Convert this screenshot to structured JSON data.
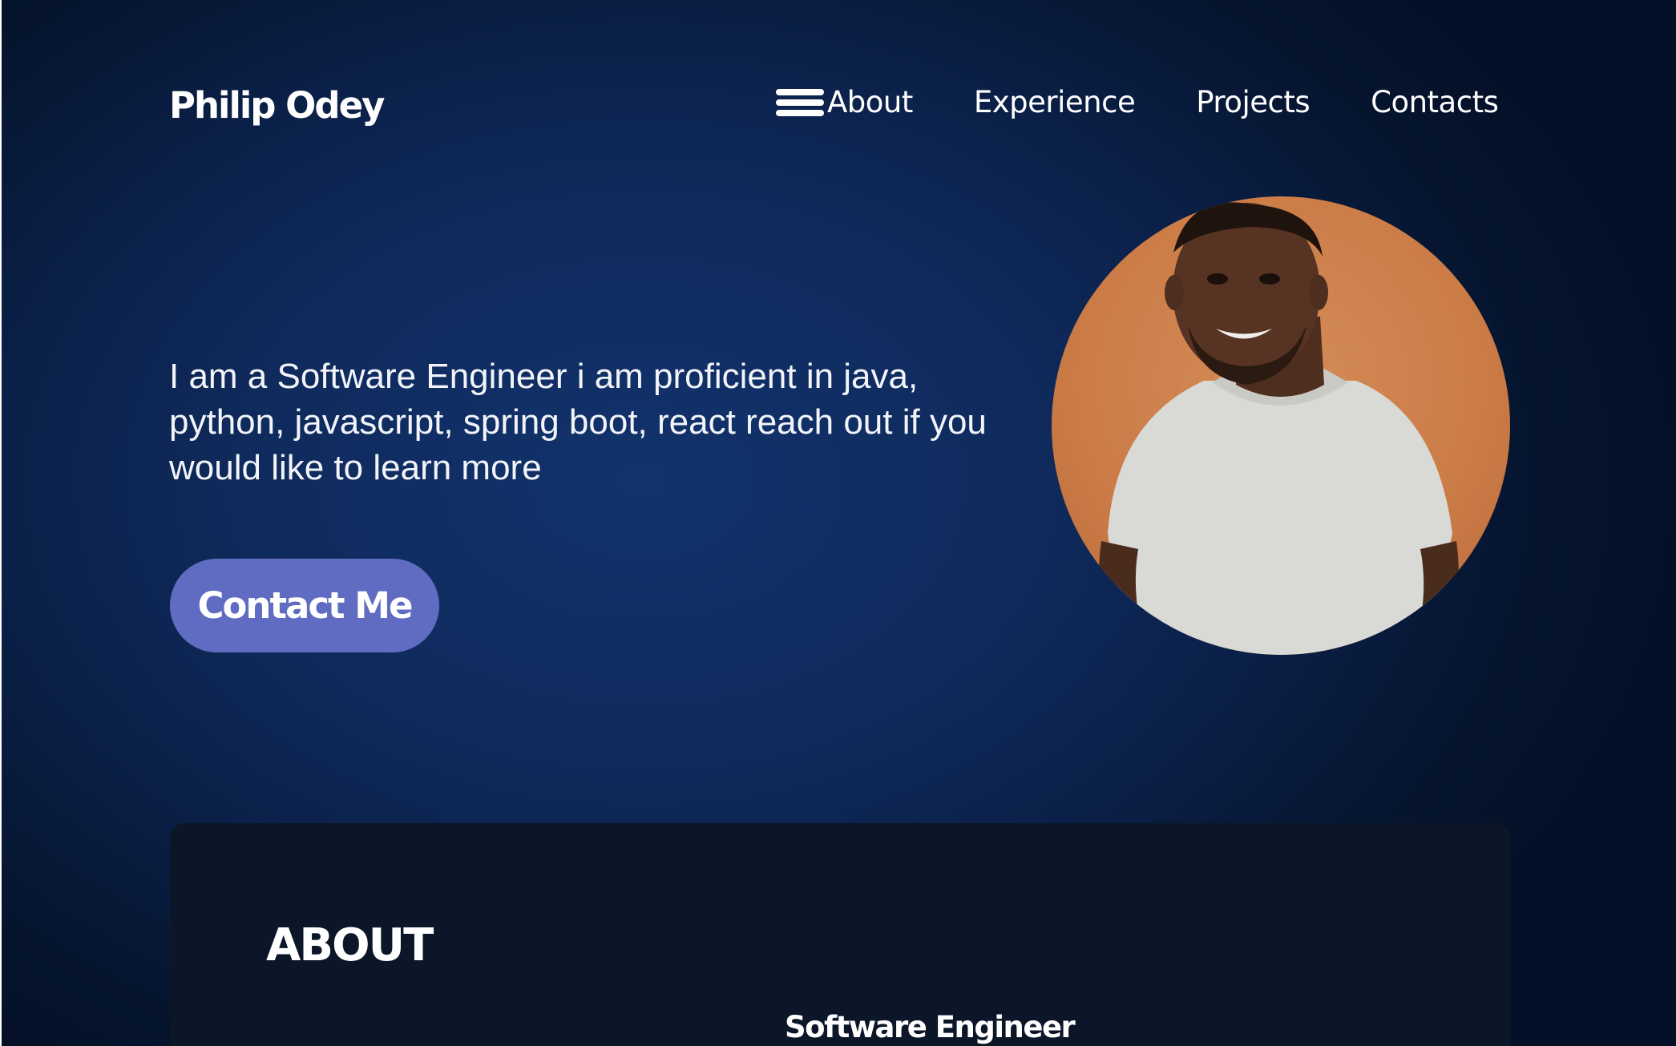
{
  "header": {
    "brand": "Philip Odey",
    "nav": [
      {
        "label": "About"
      },
      {
        "label": "Experience"
      },
      {
        "label": "Projects"
      },
      {
        "label": "Contacts"
      }
    ]
  },
  "hero": {
    "intro": "I am a Software Engineer i am proficient in java, python, javascript, spring boot, react reach out if you would like to learn more",
    "cta_label": "Contact Me",
    "photo_icon": "profile-photo"
  },
  "about": {
    "title": "ABOUT",
    "role": "Software Engineer"
  },
  "colors": {
    "background": "#0f2a5c",
    "accent": "#5f6cc2",
    "card": "#0b1628",
    "photo_background": "#cb7c47"
  }
}
